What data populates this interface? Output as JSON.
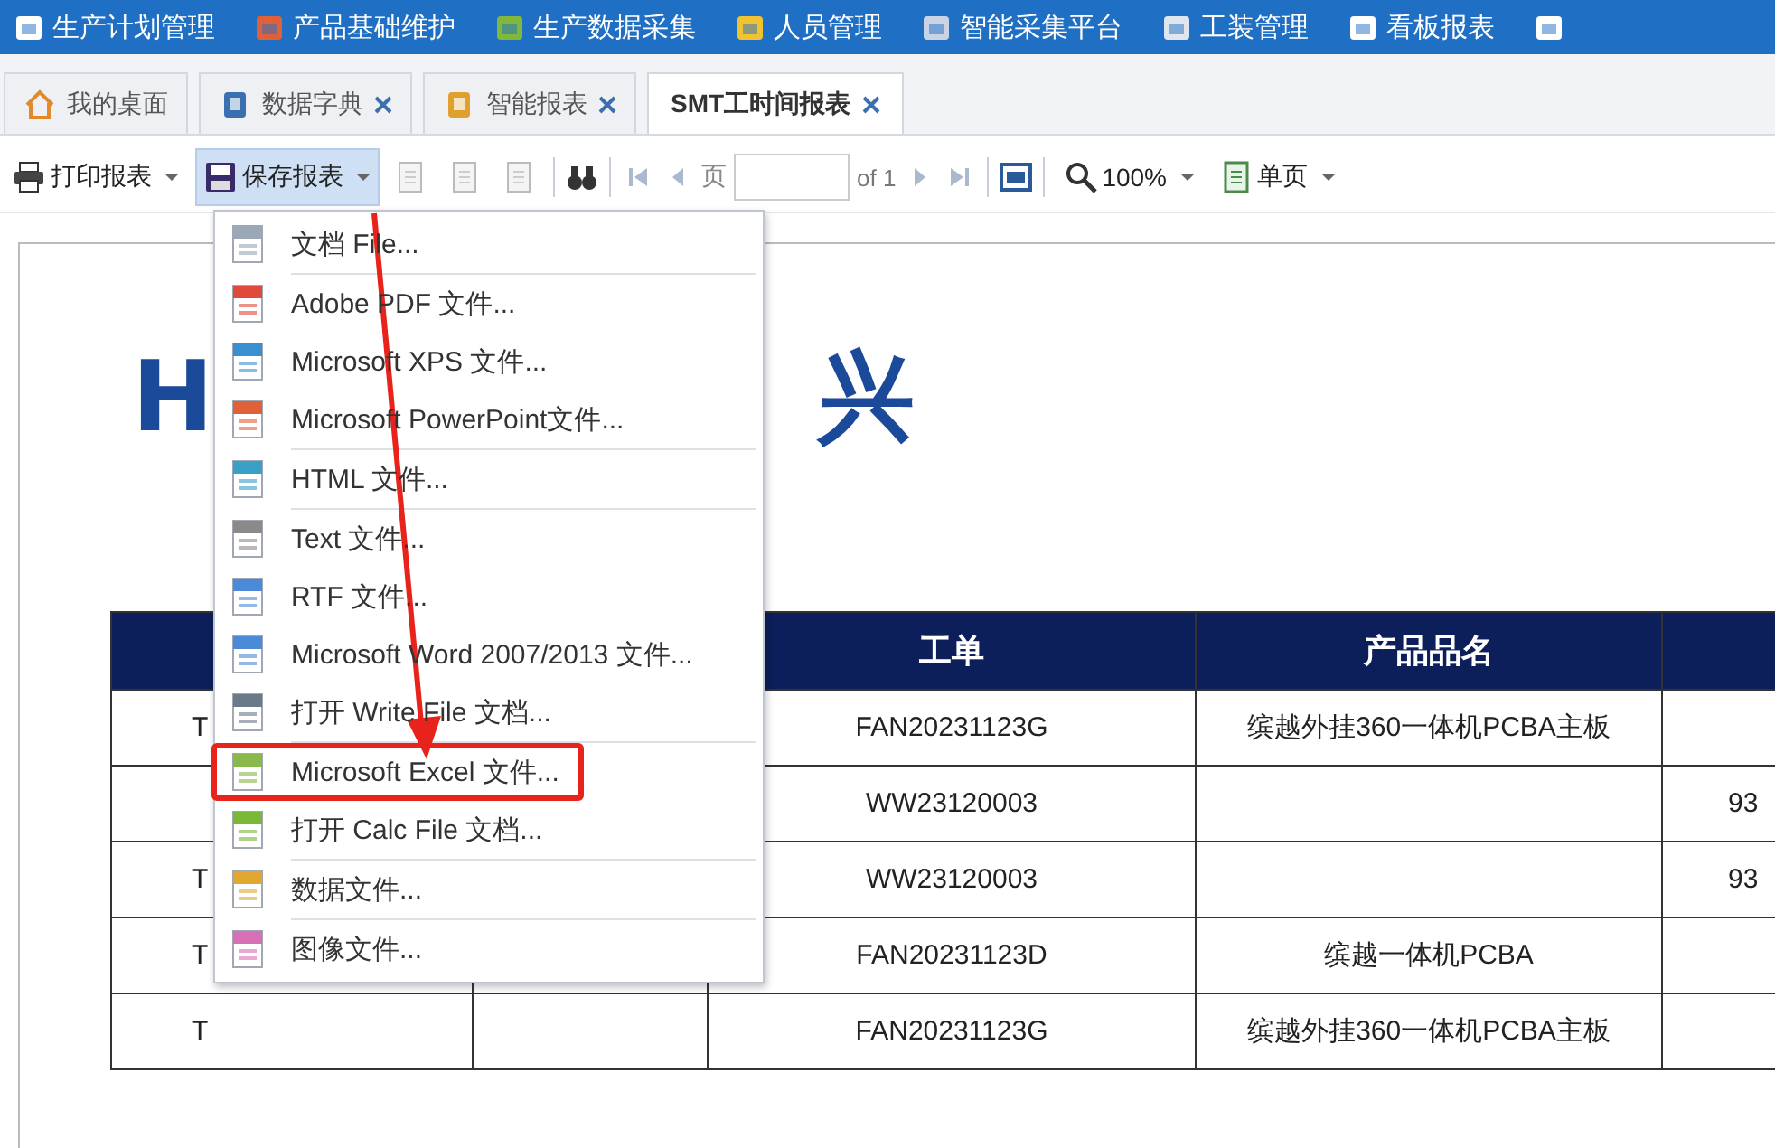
{
  "nav": [
    {
      "label": "生产计划管理",
      "color": "#ffffff"
    },
    {
      "label": "产品基础维护",
      "color": "#e0603a"
    },
    {
      "label": "生产数据采集",
      "color": "#7fb83a"
    },
    {
      "label": "人员管理",
      "color": "#f2c230"
    },
    {
      "label": "智能采集平台",
      "color": "#c8d4e4"
    },
    {
      "label": "工装管理",
      "color": "#dfe6ef"
    },
    {
      "label": "看板报表",
      "color": "#ffffff"
    }
  ],
  "tabs": [
    {
      "label": "我的桌面",
      "closable": false,
      "selected": false
    },
    {
      "label": "数据字典",
      "closable": true,
      "selected": false
    },
    {
      "label": "智能报表",
      "closable": true,
      "selected": false
    },
    {
      "label": "SMT工时间报表",
      "closable": true,
      "selected": true
    }
  ],
  "toolbar": {
    "print": "打印报表",
    "save": "保存报表",
    "save_pressed": true,
    "page_label": "页",
    "page_of": "of 1",
    "zoom": "100%",
    "view": "单页"
  },
  "logo": {
    "left": "H",
    "right": "兴"
  },
  "table": {
    "columns": [
      "",
      "",
      "工单",
      "产品品名",
      ""
    ],
    "rows": [
      [
        "T",
        "",
        "FAN20231123G",
        "缤越外挂360一体机PCBA主板",
        ""
      ],
      [
        "",
        "",
        "WW23120003",
        "",
        "93"
      ],
      [
        "T",
        "",
        "WW23120003",
        "",
        "93"
      ],
      [
        "T",
        "",
        "FAN20231123D",
        "缤越一体机PCBA",
        ""
      ],
      [
        "T",
        "",
        "FAN20231123G",
        "缤越外挂360一体机PCBA主板",
        ""
      ]
    ]
  },
  "save_menu": [
    {
      "label": "文档 File...",
      "color": "#9aa8b8",
      "separator_after": true,
      "highlighted": false
    },
    {
      "label": "Adobe PDF 文件...",
      "color": "#e04a3a",
      "separator_after": false,
      "highlighted": false
    },
    {
      "label": "Microsoft XPS 文件...",
      "color": "#3a8fd0",
      "separator_after": false,
      "highlighted": false
    },
    {
      "label": "Microsoft PowerPoint文件...",
      "color": "#e0603a",
      "separator_after": true,
      "highlighted": false
    },
    {
      "label": "HTML 文件...",
      "color": "#3aa0c8",
      "separator_after": true,
      "highlighted": false
    },
    {
      "label": "Text 文件...",
      "color": "#8a8a8a",
      "separator_after": false,
      "highlighted": false
    },
    {
      "label": "RTF 文件...",
      "color": "#4a8ad8",
      "separator_after": false,
      "highlighted": false
    },
    {
      "label": "Microsoft Word 2007/2013 文件...",
      "color": "#4a8ad8",
      "separator_after": false,
      "highlighted": false
    },
    {
      "label": "打开 Write File 文档...",
      "color": "#6a7a8a",
      "separator_after": true,
      "highlighted": false
    },
    {
      "label": "Microsoft Excel 文件...",
      "color": "#8ab84a",
      "separator_after": false,
      "highlighted": true
    },
    {
      "label": "打开 Calc File 文档...",
      "color": "#7ab83a",
      "separator_after": true,
      "highlighted": false
    },
    {
      "label": "数据文件...",
      "color": "#e0a830",
      "separator_after": true,
      "highlighted": false
    },
    {
      "label": "图像文件...",
      "color": "#d870b8",
      "separator_after": false,
      "highlighted": false
    }
  ],
  "annotation_arrow": true
}
